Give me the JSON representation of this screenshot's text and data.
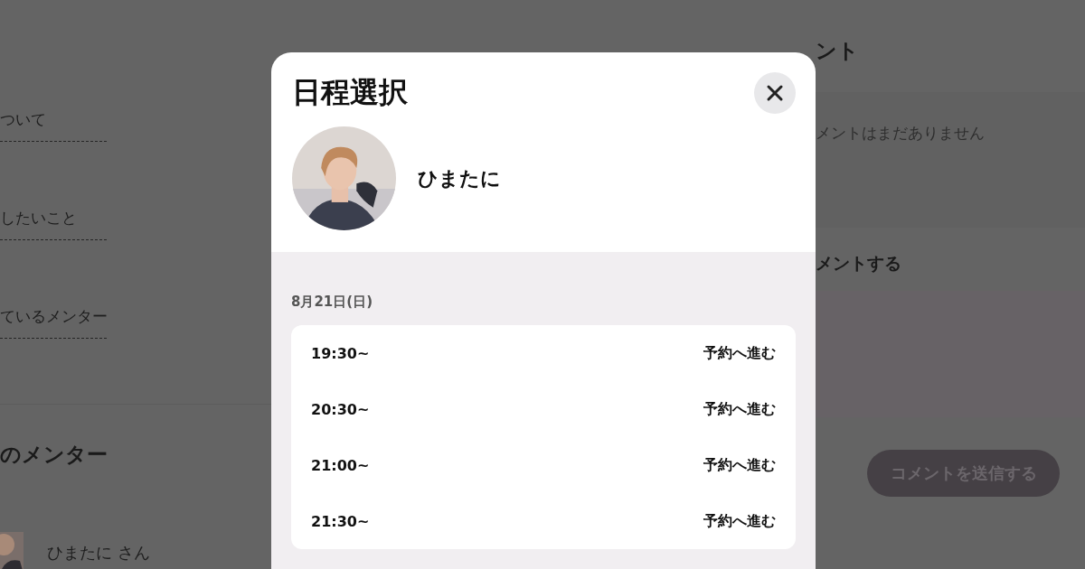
{
  "background_page": {
    "left": {
      "items": [
        {
          "label": "ついて"
        },
        {
          "label": "したいこと"
        },
        {
          "label": "ているメンター"
        }
      ],
      "mentors_heading": "のメンター",
      "mentor": {
        "name": "ひまたに さん"
      }
    },
    "right": {
      "comments_heading": "ント",
      "empty_message": "メントはまだありません",
      "compose_heading": "メントする",
      "submit_button": "コメントを送信する"
    }
  },
  "modal": {
    "title": "日程選択",
    "mentor": {
      "name": "ひまたに"
    },
    "date": "8月21日(日)",
    "slots": [
      {
        "time": "19:30~",
        "action": "予約へ進む"
      },
      {
        "time": "20:30~",
        "action": "予約へ進む"
      },
      {
        "time": "21:00~",
        "action": "予約へ進む"
      },
      {
        "time": "21:30~",
        "action": "予約へ進む"
      }
    ]
  }
}
